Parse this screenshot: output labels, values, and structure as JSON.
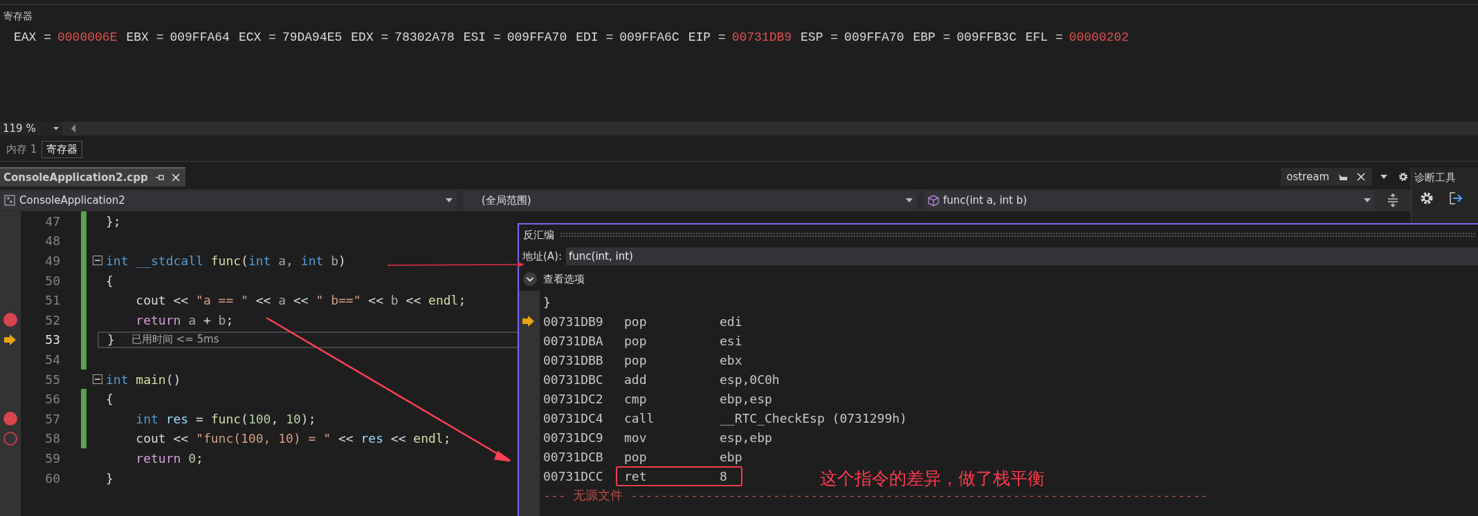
{
  "registers_panel": {
    "title": "寄存器",
    "registers": [
      {
        "name": "EAX =",
        "value": "0000006E",
        "changed": true
      },
      {
        "name": "EBX =",
        "value": "009FFA64",
        "changed": false
      },
      {
        "name": "ECX =",
        "value": "79DA94E5",
        "changed": false
      },
      {
        "name": "EDX =",
        "value": "78302A78",
        "changed": false
      },
      {
        "name": "ESI =",
        "value": "009FFA70",
        "changed": false
      },
      {
        "name": "EDI =",
        "value": "009FFA6C",
        "changed": false
      },
      {
        "name": "EIP =",
        "value": "00731DB9",
        "changed": true
      },
      {
        "name": "ESP =",
        "value": "009FFA70",
        "changed": false
      },
      {
        "name": "EBP =",
        "value": "009FFB3C",
        "changed": false
      },
      {
        "name": "EFL =",
        "value": "00000202",
        "changed": true
      }
    ]
  },
  "zoom": {
    "value": "119 %"
  },
  "panel_tabs": [
    {
      "label": "内存 1",
      "selected": false
    },
    {
      "label": "寄存器",
      "selected": true
    }
  ],
  "document_tabs": [
    {
      "label": "ConsoleApplication2.cpp",
      "selected": true
    }
  ],
  "find_tab": {
    "label": "ostream"
  },
  "navigation_bar": {
    "project": "ConsoleApplication2",
    "scope": "(全局范围)",
    "member": "func(int a, int b)"
  },
  "editor": {
    "lines": [
      {
        "number": "47",
        "breakpoint": false,
        "current": false,
        "changed": true,
        "tokens": [
          {
            "kind": "plain",
            "text": "};"
          }
        ]
      },
      {
        "number": "48",
        "breakpoint": false,
        "current": false,
        "changed": true
      },
      {
        "number": "49",
        "breakpoint": false,
        "current": false,
        "changed": true,
        "expanded": true,
        "tokens": [
          {
            "kind": "kw",
            "text": "int"
          },
          {
            "kind": "kw",
            "text": " __stdcall"
          },
          {
            "kind": "fn",
            "text": " func"
          },
          {
            "kind": "plain",
            "text": "("
          },
          {
            "kind": "kw",
            "text": "int"
          },
          {
            "kind": "param",
            "text": " a, "
          },
          {
            "kind": "kw",
            "text": "int"
          },
          {
            "kind": "param",
            "text": " b"
          },
          {
            "kind": "plain",
            "text": ")"
          }
        ]
      },
      {
        "number": "50",
        "breakpoint": false,
        "current": false,
        "changed": true,
        "tokens": [
          {
            "kind": "plain",
            "text": "{"
          }
        ]
      },
      {
        "number": "51",
        "breakpoint": false,
        "current": false,
        "changed": true,
        "tokens": [
          {
            "kind": "plain",
            "text": "    cout << "
          },
          {
            "kind": "str",
            "text": "\"a == \""
          },
          {
            "kind": "plain",
            "text": " << "
          },
          {
            "kind": "param",
            "text": "a"
          },
          {
            "kind": "plain",
            "text": " << "
          },
          {
            "kind": "str",
            "text": "\" b==\""
          },
          {
            "kind": "plain",
            "text": " << "
          },
          {
            "kind": "param",
            "text": "b"
          },
          {
            "kind": "plain",
            "text": " << "
          },
          {
            "kind": "fn",
            "text": "endl"
          },
          {
            "kind": "plain",
            "text": ";"
          }
        ]
      },
      {
        "number": "52",
        "breakpoint": true,
        "breakpoint_disabled": false,
        "current": false,
        "changed": true,
        "tokens": [
          {
            "kind": "ctl",
            "text": "    return"
          },
          {
            "kind": "param",
            "text": " a"
          },
          {
            "kind": "plain",
            "text": " + "
          },
          {
            "kind": "param",
            "text": "b"
          },
          {
            "kind": "plain",
            "text": ";"
          }
        ]
      },
      {
        "number": "53",
        "breakpoint": false,
        "current": true,
        "changed": true,
        "tokens": [
          {
            "kind": "plain",
            "text": "}"
          }
        ],
        "hint": "已用时间 <= 5ms"
      },
      {
        "number": "54",
        "breakpoint": false,
        "current": false,
        "changed": true
      },
      {
        "number": "55",
        "breakpoint": false,
        "current": false,
        "changed": false,
        "expanded": true,
        "tokens": [
          {
            "kind": "kw",
            "text": "int"
          },
          {
            "kind": "fn",
            "text": " main"
          },
          {
            "kind": "plain",
            "text": "()"
          }
        ]
      },
      {
        "number": "56",
        "breakpoint": false,
        "current": false,
        "changed": true,
        "tokens": [
          {
            "kind": "plain",
            "text": "{"
          }
        ]
      },
      {
        "number": "57",
        "breakpoint": true,
        "breakpoint_disabled": false,
        "current": false,
        "changed": true,
        "tokens": [
          {
            "kind": "kw",
            "text": "    int"
          },
          {
            "kind": "var",
            "text": " res"
          },
          {
            "kind": "plain",
            "text": " = "
          },
          {
            "kind": "fn",
            "text": "func"
          },
          {
            "kind": "plain",
            "text": "("
          },
          {
            "kind": "num",
            "text": "100"
          },
          {
            "kind": "plain",
            "text": ", "
          },
          {
            "kind": "num",
            "text": "10"
          },
          {
            "kind": "plain",
            "text": ");"
          }
        ]
      },
      {
        "number": "58",
        "breakpoint": true,
        "breakpoint_disabled": true,
        "current": false,
        "changed": true,
        "tokens": [
          {
            "kind": "plain",
            "text": "    cout << "
          },
          {
            "kind": "str",
            "text": "\"func(100, 10) = \""
          },
          {
            "kind": "plain",
            "text": " << "
          },
          {
            "kind": "var",
            "text": "res"
          },
          {
            "kind": "plain",
            "text": " << "
          },
          {
            "kind": "fn",
            "text": "endl"
          },
          {
            "kind": "plain",
            "text": ";"
          }
        ]
      },
      {
        "number": "59",
        "breakpoint": false,
        "current": false,
        "changed": false,
        "tokens": [
          {
            "kind": "ctl",
            "text": "    return"
          },
          {
            "kind": "num",
            "text": " 0"
          },
          {
            "kind": "plain",
            "text": ";"
          }
        ]
      },
      {
        "number": "60",
        "breakpoint": false,
        "current": false,
        "changed": false,
        "tokens": [
          {
            "kind": "plain",
            "text": "}"
          }
        ]
      }
    ]
  },
  "disassembly": {
    "title": "反汇编",
    "address_label": "地址(A):",
    "address": "func(int, int)",
    "options_label": "查看选项",
    "source_line": "}",
    "instructions": [
      {
        "address": "00731DB9",
        "mnemonic": "pop",
        "operand": "edi",
        "current": true,
        "highlighted": false
      },
      {
        "address": "00731DBA",
        "mnemonic": "pop",
        "operand": "esi",
        "current": false,
        "highlighted": false
      },
      {
        "address": "00731DBB",
        "mnemonic": "pop",
        "operand": "ebx",
        "current": false,
        "highlighted": false
      },
      {
        "address": "00731DBC",
        "mnemonic": "add",
        "operand": "esp,0C0h",
        "current": false,
        "highlighted": false
      },
      {
        "address": "00731DC2",
        "mnemonic": "cmp",
        "operand": "ebp,esp",
        "current": false,
        "highlighted": false
      },
      {
        "address": "00731DC4",
        "mnemonic": "call",
        "operand": "__RTC_CheckEsp (0731299h)",
        "current": false,
        "highlighted": false
      },
      {
        "address": "00731DC9",
        "mnemonic": "mov",
        "operand": "esp,ebp",
        "current": false,
        "highlighted": false
      },
      {
        "address": "00731DCB",
        "mnemonic": "pop",
        "operand": "ebp",
        "current": false,
        "highlighted": false
      },
      {
        "address": "00731DCC",
        "mnemonic": "ret",
        "operand": "8",
        "current": false,
        "highlighted": true
      }
    ],
    "footer": "--- 无源文件 -----------------------------------------------------------------------------"
  },
  "annotation": {
    "text": "这个指令的差异，做了栈平衡"
  },
  "diagnostics_panel": {
    "title": "诊断工具"
  }
}
